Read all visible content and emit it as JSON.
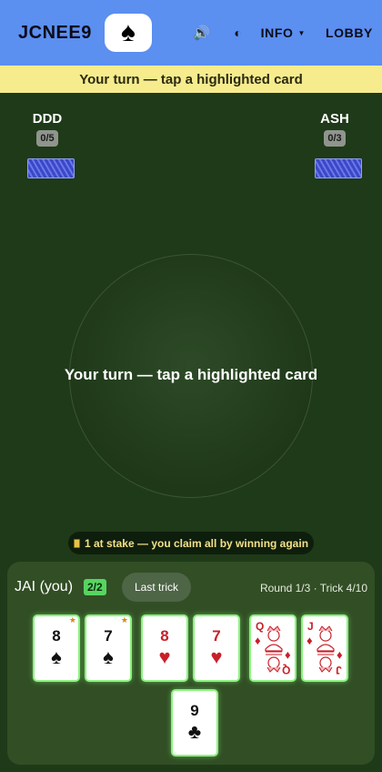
{
  "header": {
    "room_code": "JCNEE9",
    "logo_suit": "♠",
    "sound_icon": "🔊",
    "contrast_icon": "◐",
    "info_label": "INFO",
    "info_caret": "▼",
    "lobby_label": "LOBBY",
    "color": "#5b8ff0"
  },
  "banner": {
    "text": "Your turn — tap a highlighted card",
    "color": "#f6ec8e"
  },
  "opponents": [
    {
      "name": "DDD",
      "score": "0/5",
      "side": "left"
    },
    {
      "name": "ASH",
      "score": "0/3",
      "side": "right"
    }
  ],
  "table": {
    "message": "Your turn — tap a highlighted card"
  },
  "stake": {
    "text": "1 at stake — you claim all by winning again"
  },
  "player": {
    "name": "JAI (you)",
    "score": "2/2",
    "last_trick_label": "Last trick",
    "round_info": "Round 1/3 · Trick 4/10"
  },
  "hand": [
    {
      "rank": "8",
      "suit": "♠",
      "color": "black",
      "starred": true,
      "face": false
    },
    {
      "rank": "7",
      "suit": "♠",
      "color": "black",
      "starred": true,
      "face": false
    },
    {
      "rank": "8",
      "suit": "♥",
      "color": "red",
      "starred": false,
      "face": false
    },
    {
      "rank": "7",
      "suit": "♥",
      "color": "red",
      "starred": false,
      "face": false
    },
    {
      "rank": "Q",
      "suit": "♦",
      "color": "red",
      "starred": false,
      "face": true
    },
    {
      "rank": "J",
      "suit": "♦",
      "color": "red",
      "starred": false,
      "face": true
    },
    {
      "rank": "9",
      "suit": "♣",
      "color": "black",
      "starred": false,
      "face": false
    }
  ],
  "star_glyph": "★",
  "colors": {
    "felt": "#1f3a18",
    "highlight": "#8bf27f",
    "score_badge": "#57d560"
  }
}
